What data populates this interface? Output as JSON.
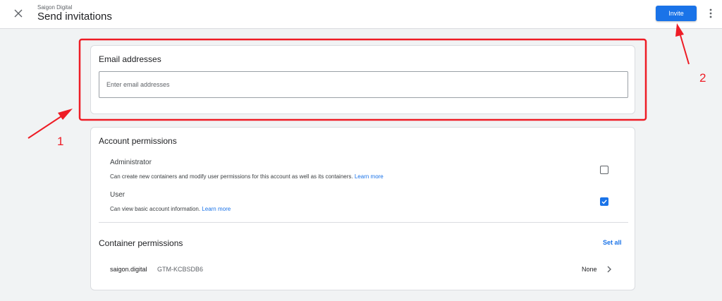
{
  "header": {
    "account_name": "Saigon Digital",
    "title": "Send invitations",
    "invite_label": "Invite"
  },
  "email_card": {
    "heading": "Email addresses",
    "input_placeholder": "Enter email addresses",
    "input_value": ""
  },
  "account_permissions": {
    "heading": "Account permissions",
    "items": [
      {
        "title": "Administrator",
        "description": "Can create new containers and modify user permissions for this account as well as its containers.",
        "link": "Learn more",
        "checked": false
      },
      {
        "title": "User",
        "description": "Can view basic account information.",
        "link": "Learn more",
        "checked": true
      }
    ]
  },
  "container_permissions": {
    "heading": "Container permissions",
    "set_all_label": "Set all",
    "rows": [
      {
        "name": "saigon.digital",
        "id": "GTM-KCBSDB6",
        "permission": "None"
      }
    ]
  },
  "annotations": {
    "labels": [
      "1",
      "2"
    ],
    "color": "#ee1c25"
  },
  "colors": {
    "accent": "#1a73e8",
    "background": "#f1f3f4",
    "annotation": "#ee1c25"
  },
  "icons": [
    "close-icon",
    "more-vert-icon",
    "checkbox-checked-icon",
    "chevron-right-icon"
  ]
}
